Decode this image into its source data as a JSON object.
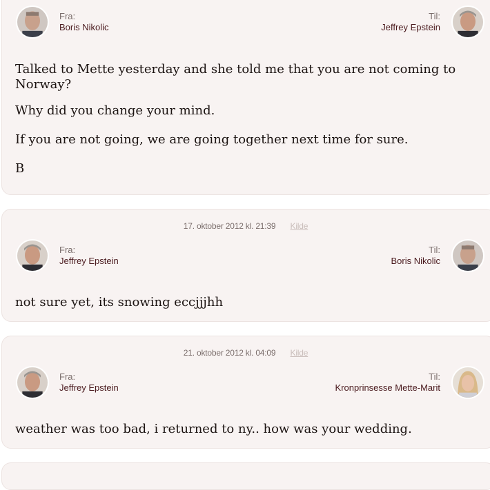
{
  "messages": [
    {
      "from_label": "Fra:",
      "from_name": "Boris Nikolic",
      "to_label": "Til:",
      "to_name": "Jeffrey Epstein",
      "body": [
        "Talked to Mette yesterday and she told me that you are not coming to Norway?",
        "Why did you change your mind.",
        "If you are not going, we are going together next time for sure.",
        "B"
      ]
    },
    {
      "date": "17. oktober 2012 kl. 21:39",
      "source_link": "Kilde",
      "from_label": "Fra:",
      "from_name": "Jeffrey Epstein",
      "to_label": "Til:",
      "to_name": "Boris Nikolic",
      "body": [
        "not sure yet, its snowing eccjjjhh"
      ]
    },
    {
      "date": "21. oktober 2012 kl. 04:09",
      "source_link": "Kilde",
      "from_label": "Fra:",
      "from_name": "Jeffrey Epstein",
      "to_label": "Til:",
      "to_name": "Kronprinsesse Mette-Marit",
      "body": [
        "weather was too bad, i returned to ny.. how was your wedding."
      ]
    }
  ],
  "colors": {
    "card_bg": "#f8f3f2",
    "name": "#4a1a1e",
    "label": "#7a6d6b",
    "body_text": "#1c1412"
  },
  "icons": {
    "boris": "avatar-boris-nikolic",
    "jeffrey": "avatar-jeffrey-epstein",
    "mette": "avatar-mette-marit"
  }
}
